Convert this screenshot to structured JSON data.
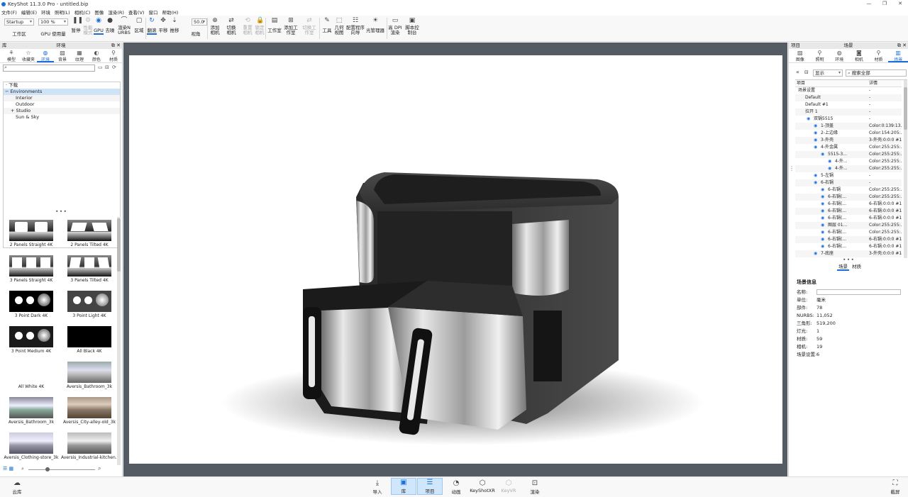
{
  "window": {
    "title": "KeyShot 11.3.0 Pro - untitled.bip",
    "controls": [
      "—",
      "❐",
      "✕"
    ]
  },
  "menu": [
    "文件(F)",
    "编辑(E)",
    "环境",
    "照明(L)",
    "相机(C)",
    "图像",
    "渲染(R)",
    "查看(V)",
    "窗口",
    "帮助(H)"
  ],
  "ribbon": {
    "workspace_select": "Startup",
    "workspace_label": "工作区",
    "zoom_select": "100 %",
    "gpu_usage_label": "GPU 使用量",
    "pause_label": "暂停",
    "perf_mode_label": "性能模式",
    "gpu_label": "GPU",
    "denoise_label": "去噪",
    "render_nurbs_label": "渲染NURBS",
    "region_label": "区域",
    "tumble_label": "翻滚",
    "pan_label": "平移",
    "dolly_label": "推移",
    "fov_value": "50.0",
    "perspective_label": "视角",
    "add_camera_label": "添加相机",
    "switch_camera_label": "切换相机",
    "reset_camera_label": "重置相机",
    "lock_camera_label": "锁定相机",
    "studio_label": "工作室",
    "add_studio_label": "添加工作室",
    "switch_studio_label": "切换工作室",
    "tools_label": "工具",
    "geometry_view_label": "几何视图",
    "config_wizard_label": "配置程序向导",
    "light_manager_label": "光管理器",
    "hidpi_label": "高 DPI 渲染",
    "script_console_label": "脚本控制台"
  },
  "left_panel": {
    "header_left": "库",
    "header": "环境",
    "tabs": [
      "模型",
      "收藏夹",
      "环境",
      "背景",
      "纹理",
      "颜色",
      "材质"
    ],
    "tree": [
      "下载",
      "Environments",
      "Interior",
      "Outdoor",
      "Studio",
      "Sun & Sky"
    ],
    "thumbnails": [
      "2 Panels Straight 4K",
      "2 Panels Tilted 4K",
      "3 Panels Straight 4K",
      "3 Panels Tilted 4K",
      "3 Point Dark 4K",
      "3 Point Light 4K",
      "3 Point Medium 4K",
      "All Black 4K",
      "All White 4K",
      "Aversis_Bathroom_3k",
      "Aversis_Bathroom_3k",
      "Aversis_City-alley-old_3k",
      "Aversis_Clothing-store_3k",
      "Aversis_Industrial-kitchen..."
    ]
  },
  "right_panel": {
    "header_left": "项目",
    "header": "场景",
    "tabs": [
      "图像",
      "照明",
      "环境",
      "相机",
      "材质",
      "场景"
    ],
    "filter_select": "显示",
    "search_placeholder": "搜索全部",
    "col_item": "项目",
    "col_detail": "详情",
    "rows": [
      {
        "name": "场景设置",
        "detail": "-"
      },
      {
        "name": "Default",
        "detail": "-"
      },
      {
        "name": "Default #1",
        "detail": "-"
      },
      {
        "name": "拉开 1",
        "detail": "-"
      },
      {
        "name": "双锅5515",
        "detail": "-"
      },
      {
        "name": "1-顶盖",
        "detail": "Color:0:139:13..."
      },
      {
        "name": "2-上边缘",
        "detail": "Color:154:205:..."
      },
      {
        "name": "3-外壳",
        "detail": "3-外壳:0:0:0 #1"
      },
      {
        "name": "4-外金属",
        "detail": "Color:255:255:..."
      },
      {
        "name": "5515-3...",
        "detail": "Color:255:255:..."
      },
      {
        "name": "4-外...",
        "detail": "Color:255:255:..."
      },
      {
        "name": "4-外...",
        "detail": "Color:255:255:..."
      },
      {
        "name": "5-左锅",
        "detail": "-"
      },
      {
        "name": "6-右锅",
        "detail": "-"
      },
      {
        "name": "6-右锅",
        "detail": "Color:255:255:..."
      },
      {
        "name": "6-右锅(...",
        "detail": "Color:255:255:..."
      },
      {
        "name": "6-右锅(...",
        "detail": "6-右锅:0:0:0 #1"
      },
      {
        "name": "6-右锅(...",
        "detail": "6-右锅:0:0:0 #1"
      },
      {
        "name": "6-右锅(...",
        "detail": "6-右锅:0:0:0 #1"
      },
      {
        "name": "图层 01...",
        "detail": "Color:255:255:..."
      },
      {
        "name": "6-右锅(...",
        "detail": "Color:255:255:..."
      },
      {
        "name": "6-右锅(...",
        "detail": "6-右锅:0:0:0 #1"
      },
      {
        "name": "6-右锅(...",
        "detail": "6-右锅:0:0:0 #1"
      },
      {
        "name": "7-底座",
        "detail": "3-外壳:0:0:0 #1"
      }
    ],
    "subtabs": [
      "场景",
      "材质"
    ],
    "info_title": "场景信息",
    "info": [
      {
        "key": "名称:",
        "value": ""
      },
      {
        "key": "单位:",
        "value": "毫米"
      },
      {
        "key": "部件:",
        "value": "78"
      },
      {
        "key": "NURBS:",
        "value": "11,052"
      },
      {
        "key": "三角形:",
        "value": "519,200"
      },
      {
        "key": "灯光:",
        "value": "1"
      },
      {
        "key": "材质:",
        "value": "59"
      },
      {
        "key": "相机:",
        "value": "19"
      },
      {
        "key": "场景设置:",
        "value": "6"
      }
    ]
  },
  "bottom_bar": {
    "cloud_label": "云库",
    "buttons": [
      "导入",
      "库",
      "项目",
      "动画",
      "KeyShotXR",
      "KeyVR",
      "渲染"
    ],
    "screenshot_label": "截屏"
  },
  "colors": {
    "accent": "#1d6fd8",
    "viewport_frame": "#555b63",
    "selected_bg": "#cfe3f7"
  }
}
